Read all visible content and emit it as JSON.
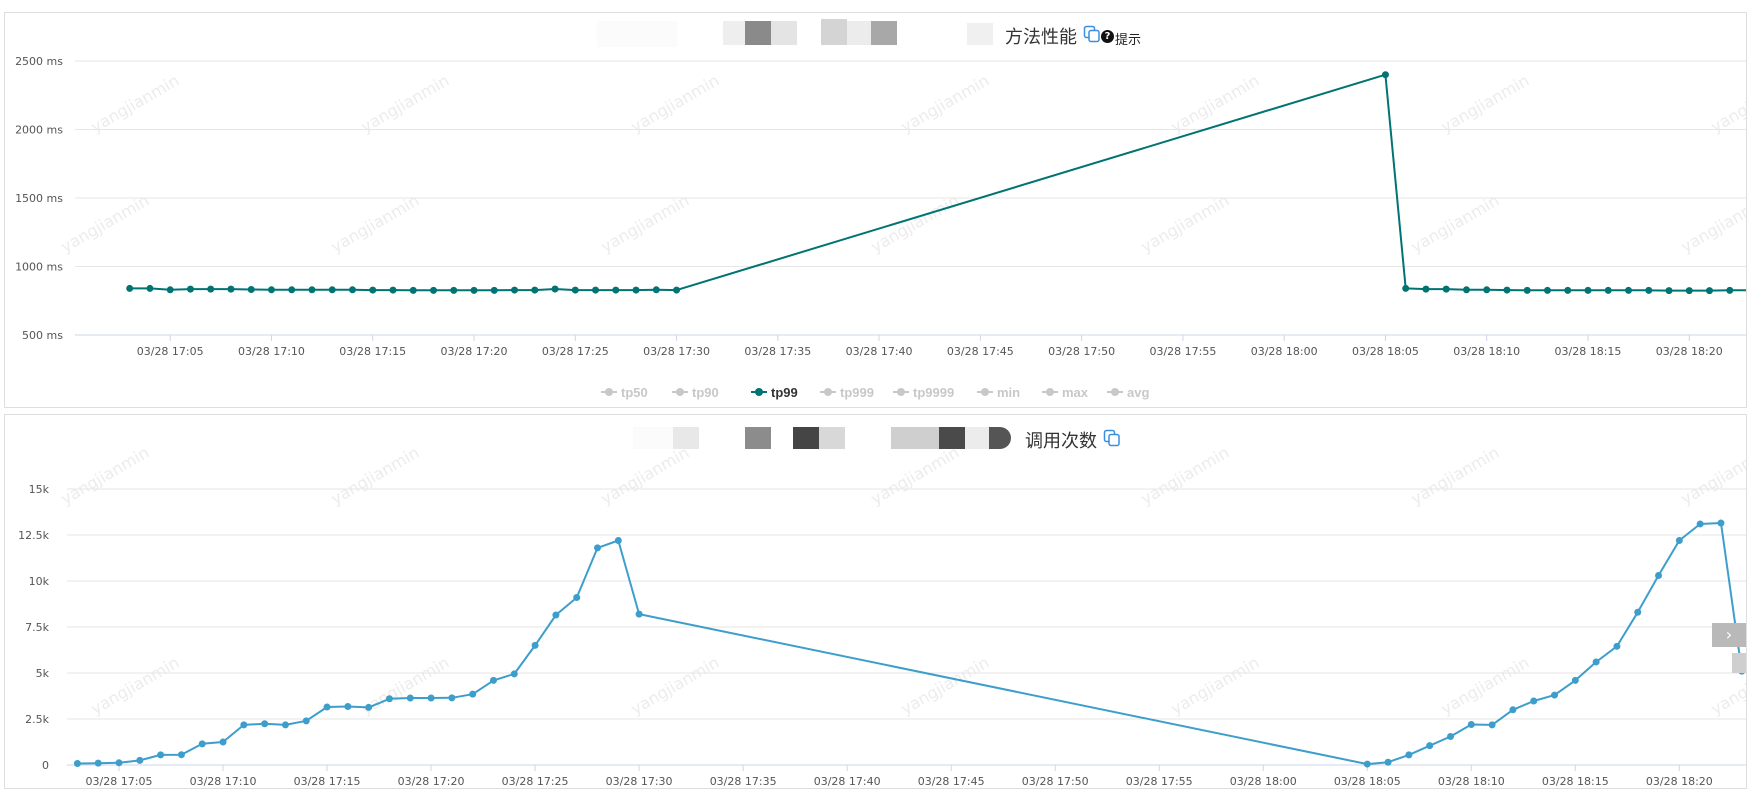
{
  "colors": {
    "tp99": "#007373",
    "calls": "#3d9ecb",
    "grid": "#e6e6e6",
    "axis_text": "#555555",
    "legend_inactive": "#c8c8c8",
    "watermark": "#ececec"
  },
  "watermark": "yangjianmin",
  "perf_panel": {
    "title": "方法性能",
    "hint": "提示",
    "copy_icon": "copy-icon",
    "hint_icon": "question-circle-icon"
  },
  "calls_panel": {
    "title": "调用次数",
    "copy_icon": "copy-icon"
  },
  "chart_data": [
    {
      "type": "line",
      "y_tick_labels": [
        "2500 ms",
        "2000 ms",
        "1500 ms",
        "1000 ms",
        "500 ms"
      ],
      "y_ticks": [
        2500,
        2000,
        1500,
        1000,
        500
      ],
      "ylim": [
        500,
        2500
      ],
      "x_tick_labels": [
        "03/28 17:05",
        "03/28 17:10",
        "03/28 17:15",
        "03/28 17:20",
        "03/28 17:25",
        "03/28 17:30",
        "03/28 17:35",
        "03/28 17:40",
        "03/28 17:45",
        "03/28 17:50",
        "03/28 17:55",
        "03/28 18:00",
        "03/28 18:05",
        "03/28 18:10",
        "03/28 18:15",
        "03/28 18:20"
      ],
      "x_tick_minutes": [
        5,
        10,
        15,
        20,
        25,
        30,
        35,
        40,
        45,
        50,
        55,
        60,
        65,
        70,
        75,
        80
      ],
      "xlim_minutes": [
        0.3,
        82.9
      ],
      "grid": true,
      "legend": {
        "position": "bottom",
        "items": [
          {
            "label": "tp50",
            "active": false
          },
          {
            "label": "tp90",
            "active": false
          },
          {
            "label": "tp99",
            "active": true
          },
          {
            "label": "tp999",
            "active": false
          },
          {
            "label": "tp9999",
            "active": false
          },
          {
            "label": "min",
            "active": false
          },
          {
            "label": "max",
            "active": false
          },
          {
            "label": "avg",
            "active": false
          }
        ]
      },
      "series": [
        {
          "name": "tp99",
          "x_minutes": [
            3,
            4,
            5,
            6,
            7,
            8,
            9,
            10,
            11,
            12,
            13,
            14,
            15,
            16,
            17,
            18,
            19,
            20,
            21,
            22,
            23,
            24,
            25,
            26,
            27,
            28,
            29,
            30,
            65,
            66,
            67,
            68,
            69,
            70,
            71,
            72,
            73,
            74,
            75,
            76,
            77,
            78,
            79,
            80,
            81,
            82,
            83
          ],
          "values": [
            840,
            840,
            830,
            835,
            835,
            835,
            832,
            830,
            830,
            830,
            830,
            830,
            828,
            828,
            826,
            826,
            826,
            826,
            826,
            828,
            828,
            836,
            828,
            828,
            828,
            828,
            830,
            828,
            2400,
            840,
            835,
            835,
            830,
            830,
            828,
            826,
            826,
            826,
            826,
            826,
            826,
            826,
            824,
            824,
            824,
            826,
            826,
            824
          ]
        }
      ]
    },
    {
      "type": "line",
      "y_tick_labels": [
        "15k",
        "12.5k",
        "10k",
        "7.5k",
        "5k",
        "2.5k",
        "0"
      ],
      "y_ticks": [
        15000,
        12500,
        10000,
        7500,
        5000,
        2500,
        0
      ],
      "ylim": [
        0,
        15000
      ],
      "x_tick_labels": [
        "03/28 17:05",
        "03/28 17:10",
        "03/28 17:15",
        "03/28 17:20",
        "03/28 17:25",
        "03/28 17:30",
        "03/28 17:35",
        "03/28 17:40",
        "03/28 17:45",
        "03/28 17:50",
        "03/28 17:55",
        "03/28 18:00",
        "03/28 18:05",
        "03/28 18:10",
        "03/28 18:15",
        "03/28 18:20"
      ],
      "x_tick_minutes": [
        5,
        10,
        15,
        20,
        25,
        30,
        35,
        40,
        45,
        50,
        55,
        60,
        65,
        70,
        75,
        80
      ],
      "xlim_minutes": [
        2.5,
        83.3
      ],
      "grid": true,
      "series": [
        {
          "name": "调用次数",
          "x_minutes": [
            3,
            4,
            5,
            6,
            7,
            8,
            9,
            10,
            11,
            12,
            13,
            14,
            15,
            16,
            17,
            18,
            19,
            20,
            21,
            22,
            23,
            24,
            25,
            26,
            27,
            28,
            29,
            30,
            65,
            66,
            67,
            68,
            69,
            70,
            71,
            72,
            73,
            74,
            75,
            76,
            77,
            78,
            79,
            80,
            81,
            82,
            83
          ],
          "values": [
            80,
            100,
            120,
            250,
            550,
            560,
            1150,
            1250,
            2180,
            2240,
            2180,
            2400,
            3150,
            3180,
            3130,
            3600,
            3640,
            3640,
            3650,
            3850,
            4600,
            4950,
            6500,
            8150,
            9100,
            11800,
            12200,
            8200,
            50,
            150,
            550,
            1050,
            1550,
            2200,
            2180,
            3000,
            3480,
            3800,
            4600,
            5600,
            6450,
            8300,
            10300,
            12200,
            13100,
            13150,
            5100
          ]
        }
      ]
    }
  ]
}
